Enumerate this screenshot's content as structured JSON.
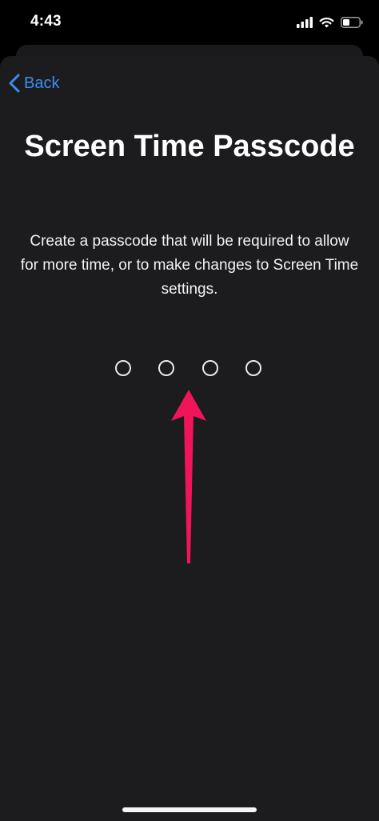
{
  "status_bar": {
    "time": "4:43",
    "icons": [
      "cellular-signal-icon",
      "wifi-icon",
      "battery-icon"
    ]
  },
  "nav": {
    "back_label": "Back"
  },
  "content": {
    "title": "Screen Time Passcode",
    "description": "Create a passcode that will be required to allow for more time, or to make changes to Screen Time settings.",
    "passcode_length": 4,
    "passcode_entered": 0
  },
  "colors": {
    "accent": "#3b8ef0",
    "annotation_arrow": "#f0145a",
    "background": "#1c1c1e"
  }
}
